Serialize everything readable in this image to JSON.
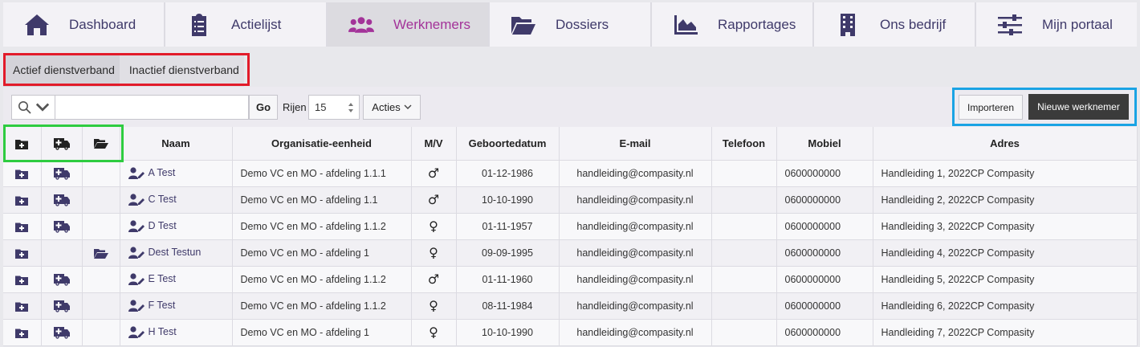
{
  "nav": {
    "items": [
      {
        "label": "Dashboard",
        "icon": "home-icon"
      },
      {
        "label": "Actielijst",
        "icon": "clipboard-icon"
      },
      {
        "label": "Werknemers",
        "icon": "users-icon",
        "active": true
      },
      {
        "label": "Dossiers",
        "icon": "folder-open-icon"
      },
      {
        "label": "Rapportages",
        "icon": "area-chart-icon"
      },
      {
        "label": "Ons bedrijf",
        "icon": "building-icon"
      },
      {
        "label": "Mijn portaal",
        "icon": "sliders-icon"
      }
    ],
    "active_color": "#a33399",
    "text_color": "#3f3a6a"
  },
  "tabs": {
    "active": "Actief dienstverband",
    "inactive": "Inactief dienstverband"
  },
  "toolbar": {
    "go_label": "Go",
    "rijen_label": "Rijen",
    "rijen_value": "15",
    "acties_label": "Acties",
    "import_label": "Importeren",
    "new_label": "Nieuwe werknemer",
    "search_value": ""
  },
  "table": {
    "headers": {
      "naam": "Naam",
      "org": "Organisatie-eenheid",
      "mv": "M/V",
      "geboortedatum": "Geboortedatum",
      "email": "E-mail",
      "telefoon": "Telefoon",
      "mobiel": "Mobiel",
      "adres": "Adres"
    },
    "rows": [
      {
        "naam": "A Test",
        "org": "Demo VC en MO - afdeling 1.1.1",
        "mv": "♂",
        "geboortedatum": "01-12-1986",
        "email": "handleiding@compasity.nl",
        "telefoon": "",
        "mobiel": "0600000000",
        "adres": "Handleiding 1, 2022CP Compasity",
        "verzuim": true,
        "dossier": false
      },
      {
        "naam": "C Test",
        "org": "Demo VC en MO - afdeling 1.1",
        "mv": "♂",
        "geboortedatum": "10-10-1990",
        "email": "handleiding@compasity.nl",
        "telefoon": "",
        "mobiel": "0600000000",
        "adres": "Handleiding 2, 2022CP Compasity",
        "verzuim": true,
        "dossier": false
      },
      {
        "naam": "D Test",
        "org": "Demo VC en MO - afdeling 1.1.2",
        "mv": "♀",
        "geboortedatum": "01-11-1957",
        "email": "handleiding@compasity.nl",
        "telefoon": "",
        "mobiel": "0600000000",
        "adres": "Handleiding 3, 2022CP Compasity",
        "verzuim": true,
        "dossier": false
      },
      {
        "naam": "Dest Testun",
        "org": "Demo VC en MO - afdeling 1",
        "mv": "♀",
        "geboortedatum": "09-09-1995",
        "email": "handleiding@compasity.nl",
        "telefoon": "",
        "mobiel": "0600000000",
        "adres": "Handleiding 4, 2022CP Compasity",
        "verzuim": false,
        "dossier": true
      },
      {
        "naam": "E Test",
        "org": "Demo VC en MO - afdeling 1.1.2",
        "mv": "♂",
        "geboortedatum": "01-11-1960",
        "email": "handleiding@compasity.nl",
        "telefoon": "",
        "mobiel": "0600000000",
        "adres": "Handleiding 5, 2022CP Compasity",
        "verzuim": true,
        "dossier": false
      },
      {
        "naam": "F Test",
        "org": "Demo VC en MO - afdeling 1.1.2",
        "mv": "♀",
        "geboortedatum": "08-11-1984",
        "email": "handleiding@compasity.nl",
        "telefoon": "",
        "mobiel": "0600000000",
        "adres": "Handleiding 6, 2022CP Compasity",
        "verzuim": true,
        "dossier": false
      },
      {
        "naam": "H Test",
        "org": "Demo VC en MO - afdeling 1",
        "mv": "♀",
        "geboortedatum": "10-10-1990",
        "email": "handleiding@compasity.nl",
        "telefoon": "",
        "mobiel": "0600000000",
        "adres": "Handleiding 7, 2022CP Compasity",
        "verzuim": true,
        "dossier": false
      }
    ]
  },
  "annotations": {
    "red": "#e21b2a",
    "blue": "#1aa3e4",
    "green": "#2ecc40"
  }
}
